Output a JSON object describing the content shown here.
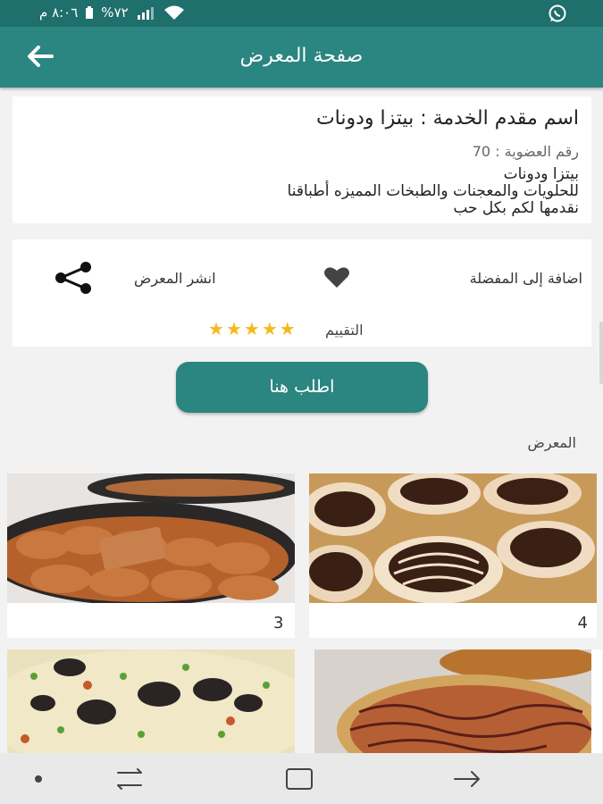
{
  "status_bar": {
    "time": "٨:٠٦ م",
    "battery": "%٧٢",
    "app_icon": "whatsapp-icon"
  },
  "app_bar": {
    "title": "صفحة المعرض",
    "back_icon": "arrow-left-icon"
  },
  "info": {
    "provider": "اسم مقدم الخدمة : بيتزا ودونات",
    "member": "رقم العضوية : 70",
    "description": "بيتزا ودونات\nللحلويات والمعجنات والطبخات المميزه أطباقنا\nنقدمها لكم بكل حب"
  },
  "actions": {
    "favorite_label": "اضافة إلى المفضلة",
    "share_label": "انشر المعرض",
    "rating_label": "التقييم",
    "rating": 5
  },
  "order_button": "اطلب هنا",
  "gallery": {
    "title": "المعرض",
    "items": [
      {
        "number": "4"
      },
      {
        "number": "3"
      },
      {
        "number": ""
      },
      {
        "number": ""
      }
    ]
  },
  "colors": {
    "primary": "#2b8581",
    "status": "#1f6f6c",
    "star": "#f5b91d"
  }
}
